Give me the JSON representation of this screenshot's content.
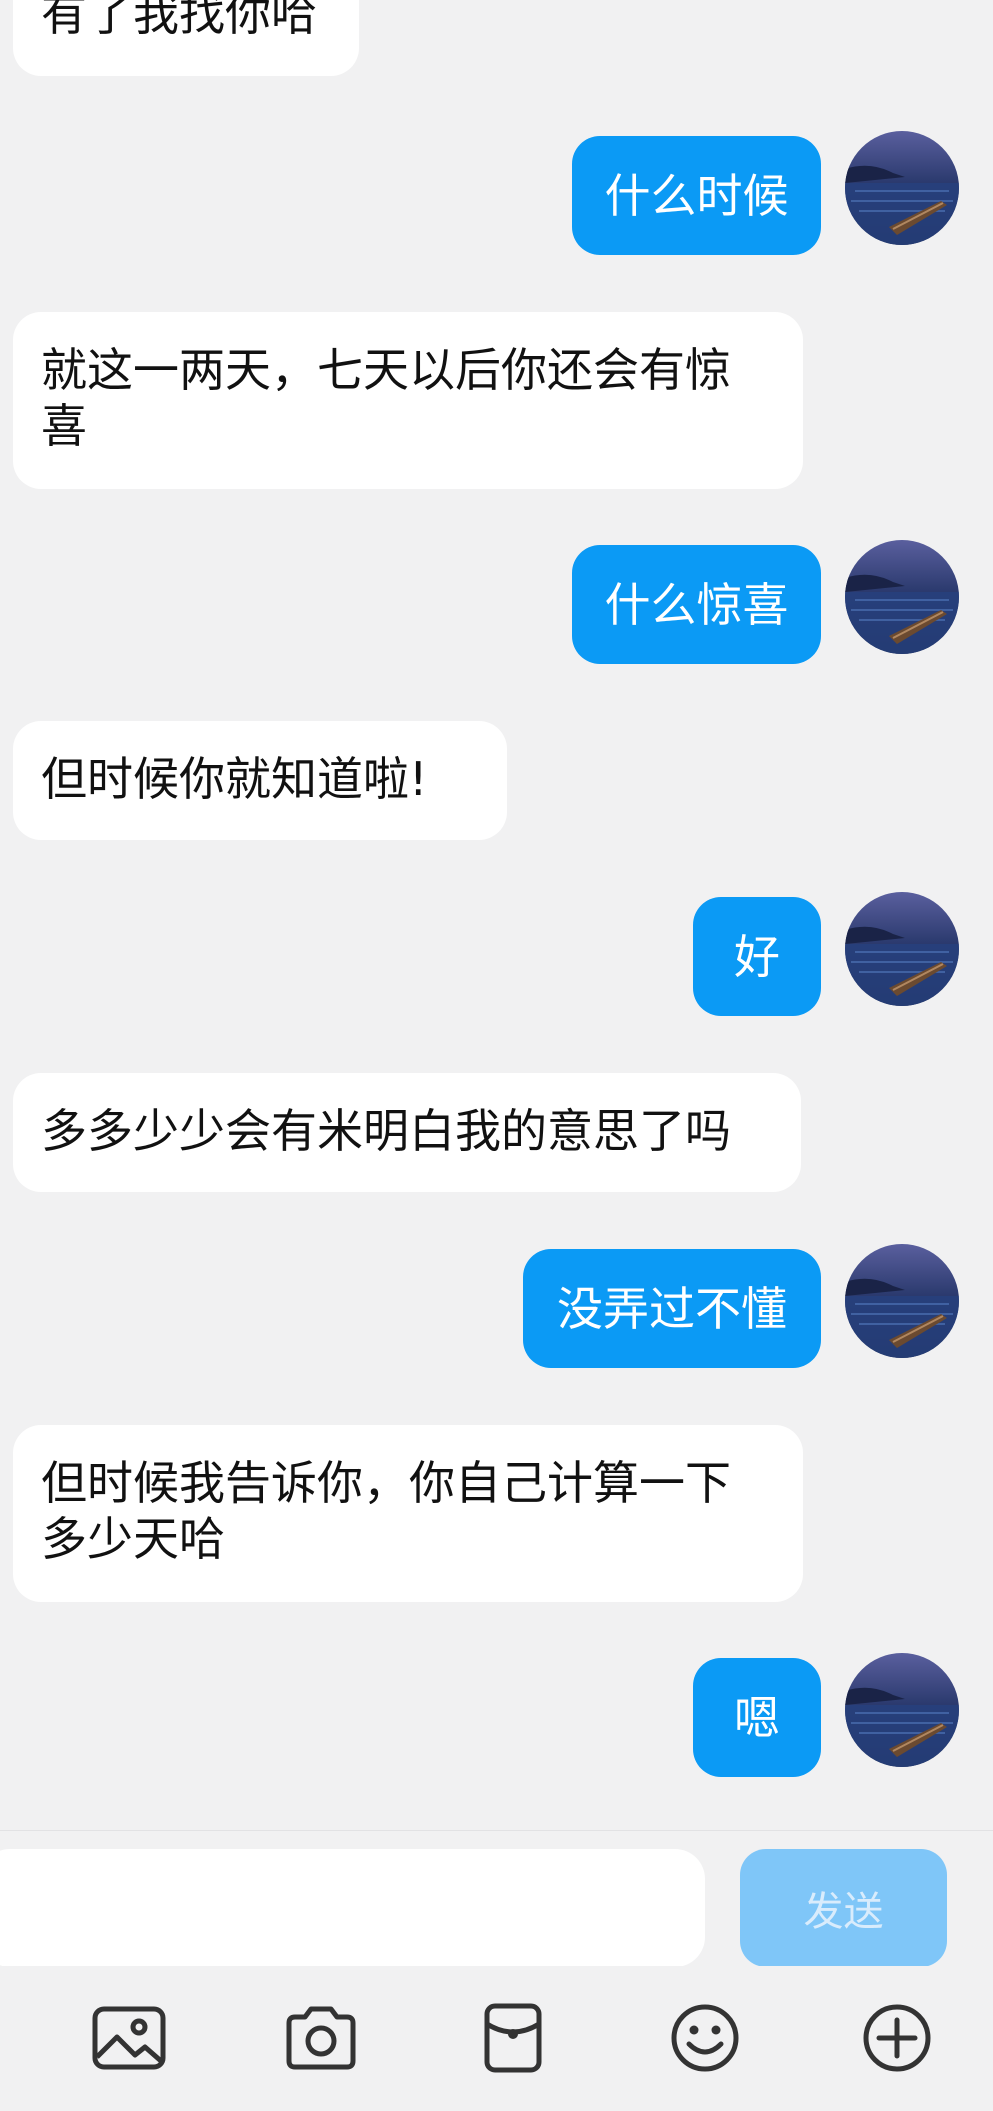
{
  "messages": [
    {
      "side": "in",
      "text": "有了我找你哈"
    },
    {
      "side": "out",
      "text": "什么时候",
      "avatar_icon": "boat-at-night-avatar"
    },
    {
      "side": "in",
      "text": "就这一两天，七天以后你还会有惊喜"
    },
    {
      "side": "out",
      "text": "什么惊喜",
      "avatar_icon": "boat-at-night-avatar"
    },
    {
      "side": "in",
      "text": "但时候你就知道啦!"
    },
    {
      "side": "out",
      "text": "好",
      "avatar_icon": "boat-at-night-avatar"
    },
    {
      "side": "in",
      "text": "多多少少会有米明白我的意思了吗"
    },
    {
      "side": "out",
      "text": "没弄过不懂",
      "avatar_icon": "boat-at-night-avatar"
    },
    {
      "side": "in",
      "text": "但时候我告诉你，你自己计算一下多少天哈"
    },
    {
      "side": "out",
      "text": "嗯",
      "avatar_icon": "boat-at-night-avatar"
    }
  ],
  "composer": {
    "input_value": "",
    "input_placeholder": "",
    "send_label": "发送"
  },
  "toolbar": {
    "items": [
      {
        "icon": "image-icon"
      },
      {
        "icon": "camera-icon"
      },
      {
        "icon": "red-packet-icon"
      },
      {
        "icon": "emoji-icon"
      },
      {
        "icon": "plus-icon"
      }
    ]
  },
  "colors": {
    "background": "#f1f1f2",
    "incoming_bubble": "#ffffff",
    "outgoing_bubble": "#0b9af5",
    "send_button_disabled": "#7fc6f8",
    "icon": "#333333"
  }
}
